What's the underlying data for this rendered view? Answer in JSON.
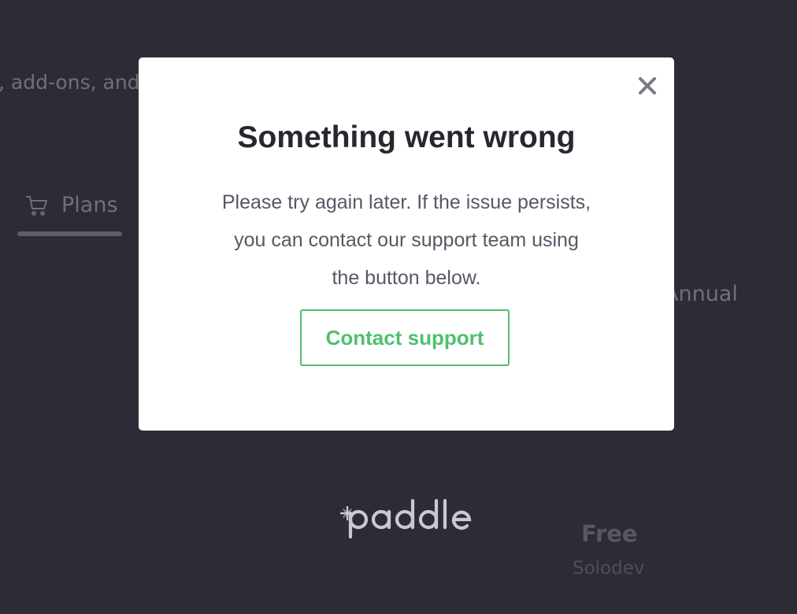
{
  "background": {
    "subtitle_fragment": ", add-ons, and",
    "tabs": [
      {
        "label": "Plans",
        "icon": "cart-icon",
        "active": true
      }
    ],
    "billing_toggle_fragment": "Annual",
    "brand_logo": "paddle",
    "plan": {
      "name": "Free",
      "subtitle": "Solodev"
    }
  },
  "modal": {
    "close_icon": "close-icon",
    "title": "Something went wrong",
    "message_lines": [
      "Please try again later. If the issue persists,",
      "you can contact our support team using",
      "the button below."
    ],
    "contact_button_label": "Contact support",
    "accent_color": "#4fc06f"
  }
}
